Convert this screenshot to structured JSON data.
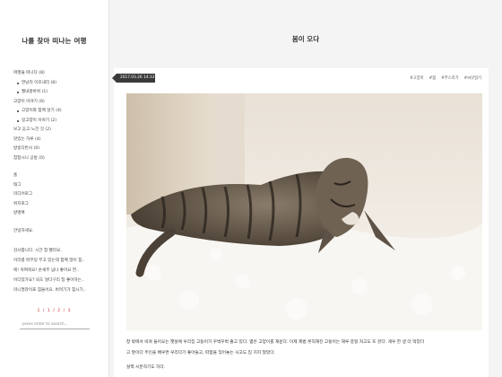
{
  "blog": {
    "title": "나를 찾아 떠나는 여행"
  },
  "sidebar": {
    "categories": [
      {
        "label": "여행을 떠나다 (8)",
        "sub": false
      },
      {
        "label": "연남리 이모내리 (8)",
        "sub": true
      },
      {
        "label": "월내항바위 (1)",
        "sub": true
      },
      {
        "label": "고양이 이야기 (6)",
        "sub": false
      },
      {
        "label": "고양이와 함께 살기 (4)",
        "sub": true
      },
      {
        "label": "길고양이 이야기 (2)",
        "sub": true
      },
      {
        "label": "보고 듣고 느낀 것 (2)",
        "sub": false
      },
      {
        "label": "맛있는 하루 (4)",
        "sub": false
      },
      {
        "label": "방송다반사 (0)",
        "sub": false
      },
      {
        "label": "참참시니 공방 (0)",
        "sub": false
      }
    ],
    "menu": [
      "홈",
      "태그",
      "미디어로그",
      "위치로그",
      "방명록"
    ],
    "greeting": "안녕하세요.",
    "recent": [
      "감사합니다. 시간 참 빨라요.",
      "이러를 떠부덩 부고 있는데 함께 많이 힘..",
      "애! 귀여워요! 손세주 넘나 좋아요 한..",
      "어디었가요? 되도 달다구리 참 좋아하는..",
      "미니멀라이프 힘들어요. 버려기가 힘시기.."
    ],
    "counter": "1 / 1 / 2 / 3",
    "search_placeholder": "press enter to search..."
  },
  "post": {
    "title": "봄이 오다",
    "date": "2017.03.26 14:33",
    "tags": [
      "#고양이",
      "#봄",
      "#부스러기",
      "#씨앗일기"
    ],
    "image_alt": "sleeping tabby cat on a white fluffy blanket",
    "paragraphs": [
      "창 밖에서 비쳐 들어오는 햇살에 우리집 고등어가 꾸벅꾸벅 졸고 있다. 엷은 고양이를 재운다. 이제 제법 뭇직해진 고등어는 해루 종일 자고도 또 잔다. 게우 한 생 더 먹었다",
      "고 말이다 주인을 배우면 우리다기 좋아들고, 따함을 잊어놓는 사고도 입 치지 않았다.",
      "살짝 시문하기도 하다."
    ]
  },
  "colors": {
    "badge_bg": "#3a3a3a",
    "page_bg": "#f4f4f4",
    "card_bg": "#ffffff"
  }
}
